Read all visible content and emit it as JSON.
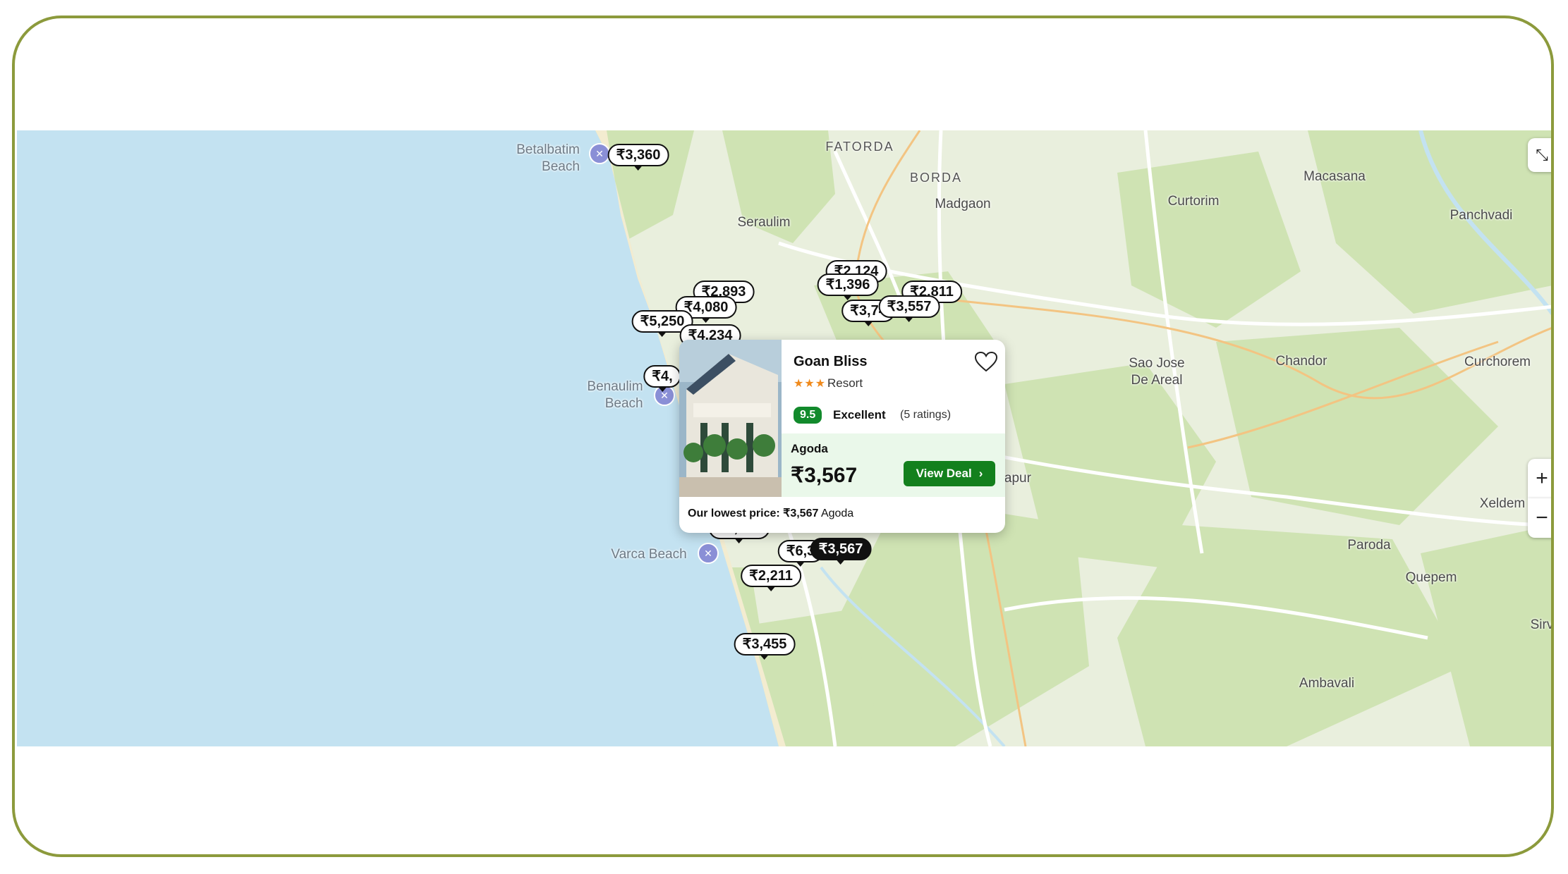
{
  "map": {
    "places": [
      {
        "id": "fatorda",
        "label": "FATORDA",
        "kind": "caps"
      },
      {
        "id": "borda",
        "label": "BORDA",
        "kind": "caps"
      },
      {
        "id": "madgaon",
        "label": "Madgaon",
        "kind": "town"
      },
      {
        "id": "seraulim",
        "label": "Seraulim",
        "kind": "town"
      },
      {
        "id": "curtorim",
        "label": "Curtorim",
        "kind": "town"
      },
      {
        "id": "macasana",
        "label": "Macasana",
        "kind": "town"
      },
      {
        "id": "panchvadi",
        "label": "Panchvadi",
        "kind": "town"
      },
      {
        "id": "sao-jose",
        "label": "Sao Jose\nDe Areal",
        "kind": "town"
      },
      {
        "id": "chandor",
        "label": "Chandor",
        "kind": "town"
      },
      {
        "id": "curchorem",
        "label": "Curchorem",
        "kind": "town"
      },
      {
        "id": "xeldem",
        "label": "Xeldem",
        "kind": "town"
      },
      {
        "id": "paroda",
        "label": "Paroda",
        "kind": "town"
      },
      {
        "id": "quepem",
        "label": "Quepem",
        "kind": "town"
      },
      {
        "id": "sirvoi",
        "label": "Sirv",
        "kind": "town"
      },
      {
        "id": "ambavali",
        "label": "Ambavali",
        "kind": "town"
      },
      {
        "id": "mapur",
        "label": "mapur",
        "kind": "town"
      },
      {
        "id": "betalbatim",
        "label": "Betalbatim\nBeach",
        "kind": "beach"
      },
      {
        "id": "benaulim",
        "label": "Benaulim\nBeach",
        "kind": "beach"
      },
      {
        "id": "varca",
        "label": "Varca Beach",
        "kind": "beach"
      }
    ],
    "price_pins": [
      {
        "id": "p1",
        "label": "₹3,360",
        "active": false
      },
      {
        "id": "p2",
        "label": "₹2,893",
        "active": false
      },
      {
        "id": "p3",
        "label": "₹4,080",
        "active": false
      },
      {
        "id": "p4",
        "label": "₹5,250",
        "active": false
      },
      {
        "id": "p5",
        "label": "₹4,234",
        "active": false
      },
      {
        "id": "p6",
        "label": "₹2,124",
        "active": false
      },
      {
        "id": "p7",
        "label": "₹1,396",
        "active": false
      },
      {
        "id": "p8",
        "label": "₹2,811",
        "active": false
      },
      {
        "id": "p9",
        "label": "₹3,74",
        "active": false
      },
      {
        "id": "p10",
        "label": "₹3,557",
        "active": false
      },
      {
        "id": "p11",
        "label": "₹4,",
        "active": false
      },
      {
        "id": "p12",
        "label": "₹6,772",
        "active": false
      },
      {
        "id": "p13",
        "label": "₹6,3",
        "active": false
      },
      {
        "id": "p14",
        "label": "₹3,567",
        "active": true
      },
      {
        "id": "p15",
        "label": "₹2,211",
        "active": false
      },
      {
        "id": "p16",
        "label": "₹3,455",
        "active": false
      }
    ],
    "controls": {
      "zoom_in": "+",
      "zoom_out": "−",
      "collapse_icon": "collapse-arrows-icon"
    },
    "colors": {
      "water": "#c3e2f1",
      "land": "#e8f0d6",
      "green": "#cde3b0",
      "road": "#ffffff",
      "major_road": "#f5c98a",
      "accent_green": "#13801d"
    }
  },
  "hotel_card": {
    "name": "Goan Bliss",
    "stars": "★★★",
    "type": "Resort",
    "score": "9.5",
    "rating_word": "Excellent",
    "rating_count": "(5 ratings)",
    "provider": "Agoda",
    "price": "₹3,567",
    "button": "View Deal",
    "lowest_label": "Our lowest price:",
    "lowest_value": "₹3,567",
    "lowest_provider": "Agoda"
  }
}
